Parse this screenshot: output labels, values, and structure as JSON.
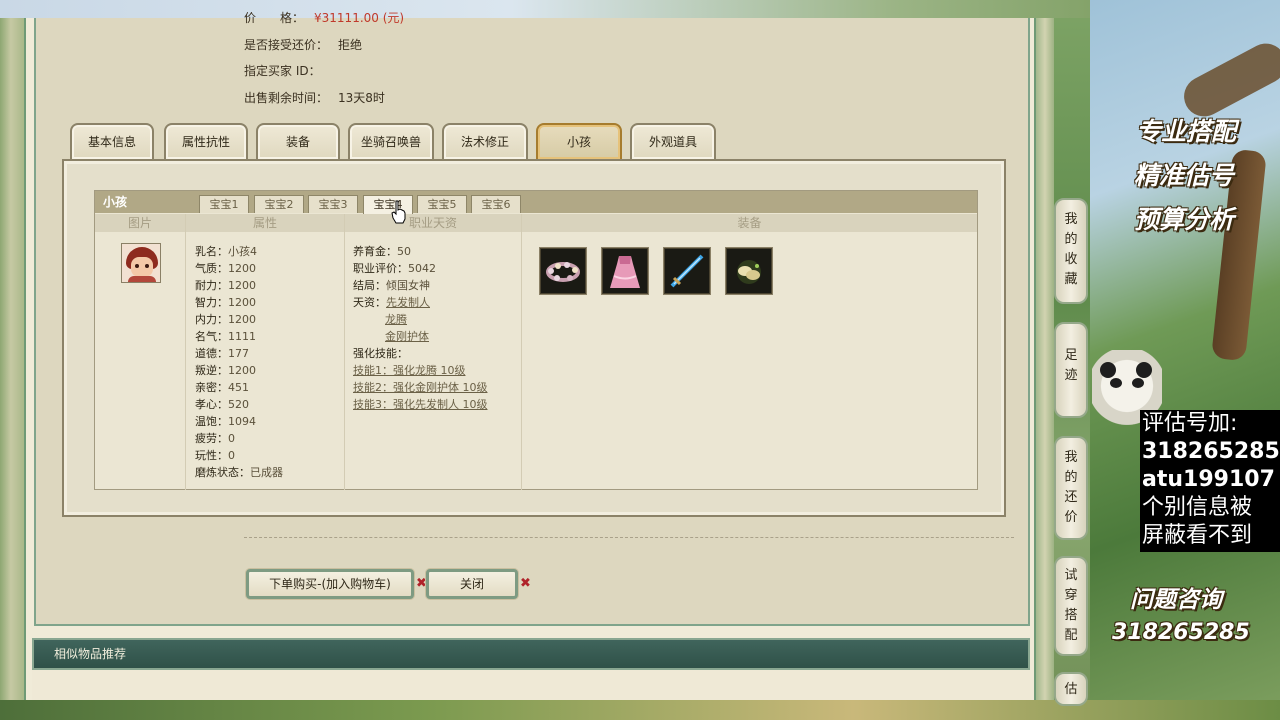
{
  "listing": {
    "price_value": "¥31111.00 (元)",
    "accept_counter_label": "是否接受还价：",
    "accept_counter_value": "拒绝",
    "buyer_id_label": "指定买家 ID：",
    "remaining_time_label": "出售剩余时间：",
    "remaining_time_value": "13天8时"
  },
  "main_tabs": [
    "基本信息",
    "属性抗性",
    "装备",
    "坐骑召唤兽",
    "法术修正",
    "小孩",
    "外观道具"
  ],
  "active_main_tab": "小孩",
  "child_panel": {
    "title": "小孩",
    "sub_tabs": [
      "宝宝1",
      "宝宝2",
      "宝宝3",
      "宝宝4",
      "宝宝5",
      "宝宝6"
    ],
    "active_sub_tab": "宝宝4",
    "columns": [
      "图片",
      "属性",
      "职业天资",
      "装备"
    ],
    "attributes": [
      {
        "k": "乳名：",
        "v": "小孩4"
      },
      {
        "k": "气质：",
        "v": "1200"
      },
      {
        "k": "耐力：",
        "v": "1200"
      },
      {
        "k": "智力：",
        "v": "1200"
      },
      {
        "k": "内力：",
        "v": "1200"
      },
      {
        "k": "名气：",
        "v": "1111"
      },
      {
        "k": "道德：",
        "v": "177"
      },
      {
        "k": "叛逆：",
        "v": "1200"
      },
      {
        "k": "亲密：",
        "v": "451"
      },
      {
        "k": "孝心：",
        "v": "520"
      },
      {
        "k": "温饱：",
        "v": "1094"
      },
      {
        "k": "疲劳：",
        "v": "0"
      },
      {
        "k": "玩性：",
        "v": "0"
      },
      {
        "k": "磨炼状态：",
        "v": "已成器"
      }
    ],
    "talents": {
      "support_label": "养育金：",
      "support_value": "50",
      "rating_label": "职业评价：",
      "rating_value": "5042",
      "ending_label": "结局：",
      "ending_value": "倾国女神",
      "talent_label": "天资：",
      "talent_1": "先发制人",
      "talent_2": "龙腾",
      "talent_3": "金刚护体",
      "skills_label": "强化技能：",
      "skill_1": "技能1：强化龙腾 10级",
      "skill_2": "技能2：强化金刚护体 10级",
      "skill_3": "技能3：强化先发制人 10级"
    },
    "equipment_icons": [
      "flower-wreath-icon",
      "pink-dress-icon",
      "blue-sword-icon",
      "jade-charm-icon"
    ]
  },
  "buttons": {
    "buy_label": "下单购买-(加入购物车)",
    "close_label": "关闭",
    "x_mark": "✖"
  },
  "recommend_title": "相似物品推荐",
  "side_tabs": [
    {
      "id": "favorites",
      "chars": [
        "我",
        "的",
        "收",
        "藏"
      ]
    },
    {
      "id": "history",
      "chars": [
        "足",
        "迹"
      ]
    },
    {
      "id": "my-offers",
      "chars": [
        "我",
        "的",
        "还",
        "价"
      ]
    },
    {
      "id": "try-on",
      "chars": [
        "试",
        "穿",
        "搭",
        "配"
      ]
    },
    {
      "id": "estimate",
      "chars": [
        "估"
      ]
    }
  ],
  "promo": {
    "line1": "专业搭配",
    "line2": "精准估号",
    "line3": "预算分析",
    "consult_label": "问题咨询",
    "consult_number": "318265285"
  },
  "contact": {
    "line1": "评估号加:",
    "line2": "318265285",
    "line3": "atu199107",
    "line4": "个别信息被",
    "line5": "屏蔽看不到"
  },
  "colors": {
    "price_red": "#c0392b",
    "active_tab_border": "#a67c2e",
    "recommend_bar": "#2f5148"
  }
}
